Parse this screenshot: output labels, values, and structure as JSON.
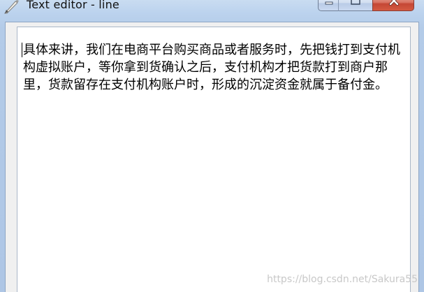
{
  "window": {
    "title": "Text editor - line",
    "app_icon": "notepad-pencil-icon",
    "controls": {
      "minimize_icon": "minimize-icon",
      "maximize_icon": "maximize-icon",
      "close_icon": "close-icon"
    }
  },
  "editor": {
    "text": "具体来讲，我们在电商平台购买商品或者服务时，先把钱打到支付机构虚拟账户，等你拿到货确认之后，支付机构才把货款打到商户那里，货款留存在支付机构账户时，形成的沉淀资金就属于备付金。"
  },
  "watermark": "https://blog.csdn.net/Sakura55",
  "colors": {
    "frame": "#b8cfe9",
    "close_button": "#c9503c",
    "editor_background": "#ffffff"
  }
}
